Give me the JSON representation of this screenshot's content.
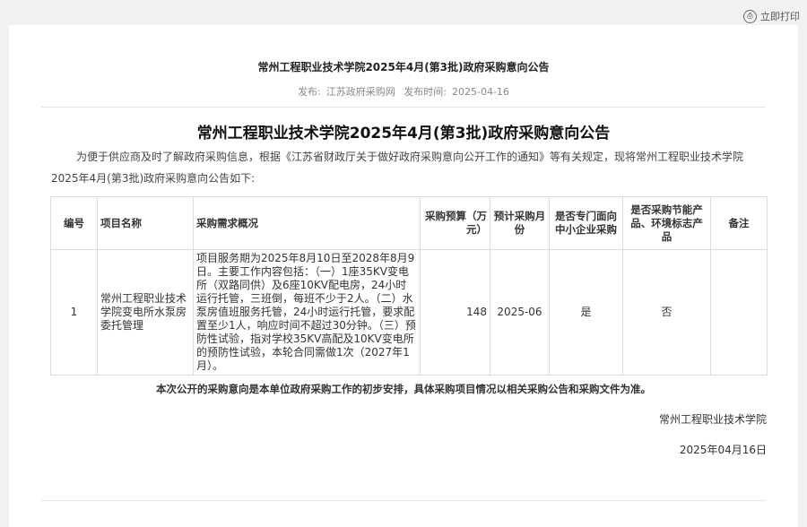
{
  "print_label": "立即打印",
  "header": {
    "title": "常州工程职业技术学院2025年4月(第3批)政府采购意向公告",
    "source_label": "发布:",
    "source": "江苏政府采购网",
    "time_label": "发布时间:",
    "time": "2025-04-16"
  },
  "article": {
    "title": "常州工程职业技术学院2025年4月(第3批)政府采购意向公告",
    "intro": "为便于供应商及时了解政府采购信息，根据《江苏省财政厅关于做好政府采购意向公开工作的通知》等有关规定，现将常州工程职业技术学院2025年4月(第3批)政府采购意向公告如下:",
    "table": {
      "headers": {
        "no": "编号",
        "name": "项目名称",
        "desc": "采购需求概况",
        "budget": "采购预算（万元）",
        "month": "预计采购月份",
        "sme": "是否专门面向中小企业采购",
        "green": "是否采购节能产品、环境标志产品",
        "remark": "备注"
      },
      "rows": [
        {
          "no": "1",
          "name": "常州工程职业技术学院变电所水泵房委托管理",
          "desc": "项目服务期为2025年8月10日至2028年8月9日。主要工作内容包括：（一）1座35KV变电所（双路同供）及6座10KV配电房，24小时运行托管，三班倒，每班不少于2人。（二）水泵房值班服务托管，24小时运行托管，要求配置至少1人，响应时间不超过30分钟。（三）预防性试验，指对学校35KV高配及10KV变电所的预防性试验，本轮合同需做1次（2027年1月）。",
          "budget": "148",
          "month": "2025-06",
          "sme": "是",
          "green": "否",
          "remark": ""
        }
      ]
    },
    "note": "本次公开的采购意向是本单位政府采购工作的初步安排，具体采购项目情况以相关采购公告和采购文件为准。",
    "sign_org": "常州工程职业技术学院",
    "sign_date": "2025年04月16日"
  }
}
